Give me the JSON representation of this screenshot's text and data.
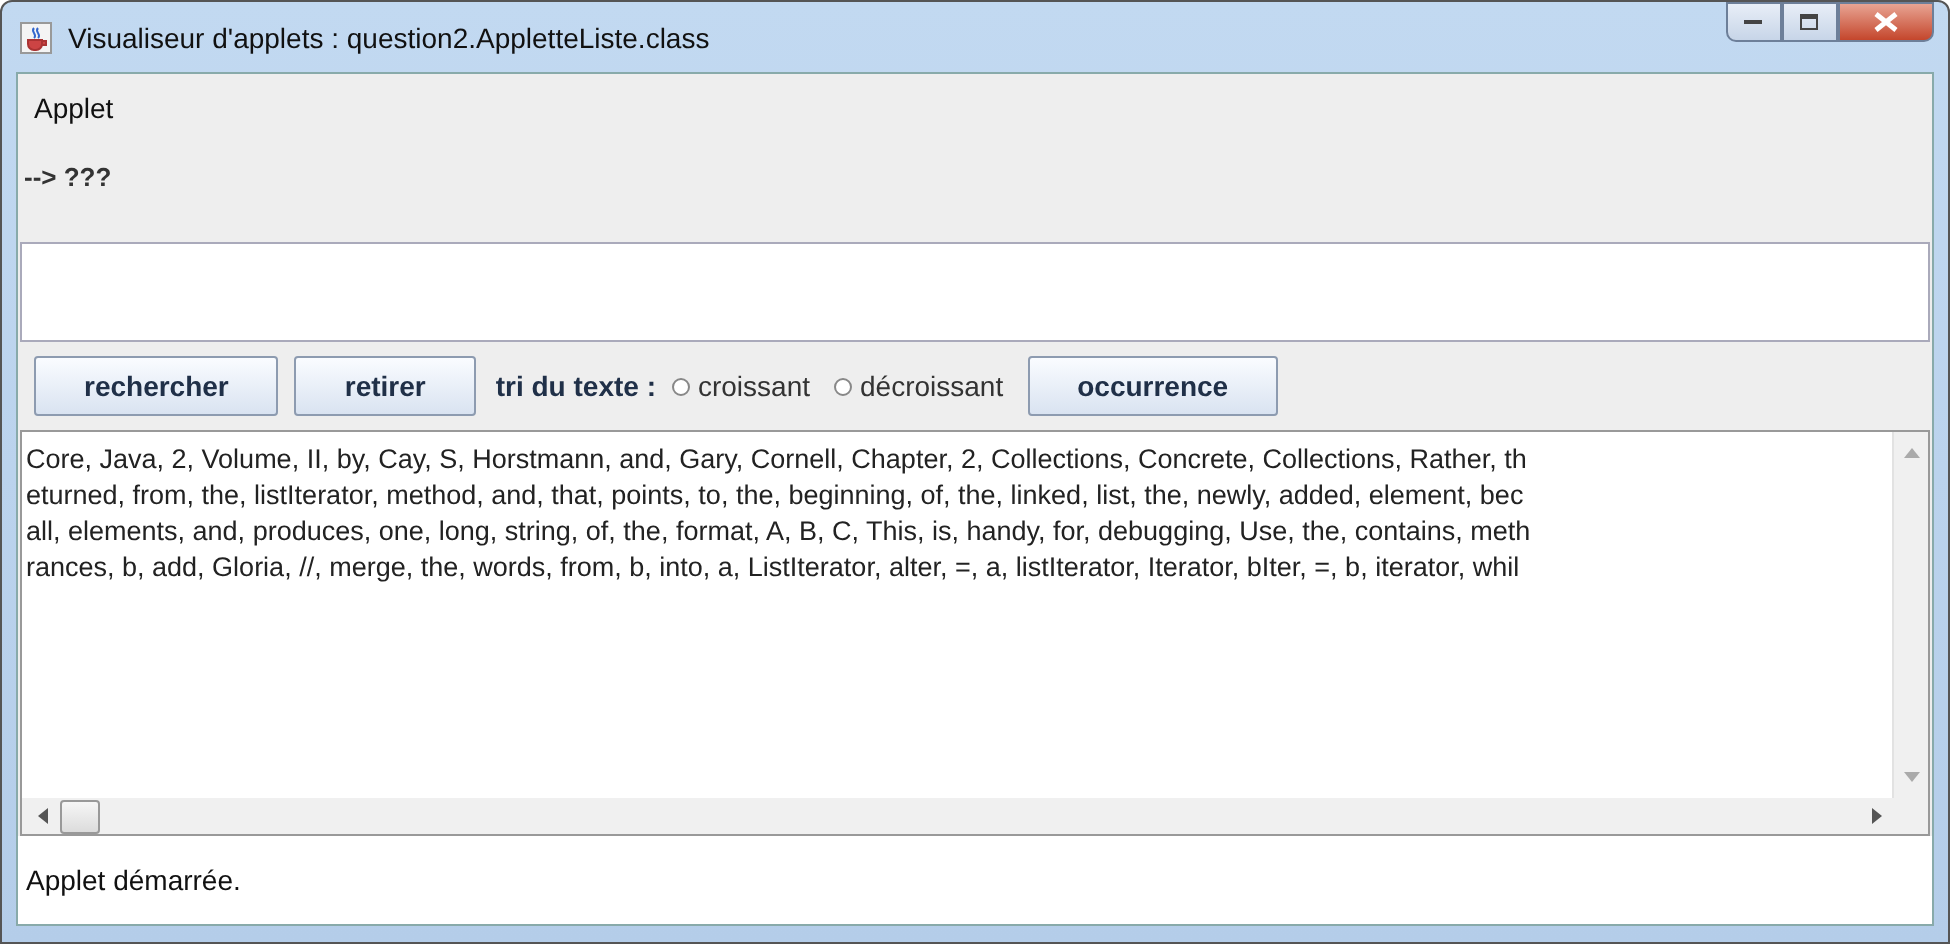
{
  "window": {
    "title": "Visualiseur d'applets : question2.AppletteListe.class"
  },
  "menu": [
    "Applet"
  ],
  "result_label": "--> ???",
  "controls": [
    {
      "kind": "button",
      "label": "rechercher"
    },
    {
      "kind": "button",
      "label": "retirer"
    },
    {
      "kind": "label",
      "label": "tri du texte :"
    },
    {
      "kind": "radio",
      "label": "croissant",
      "selected": false
    },
    {
      "kind": "radio",
      "label": "décroissant",
      "selected": false
    },
    {
      "kind": "button",
      "label": "occurrence"
    }
  ],
  "text_area": {
    "lines": [
      "Core, Java, 2, Volume, II, by, Cay, S, Horstmann, and, Gary, Cornell, Chapter, 2, Collections, Concrete, Collections, Rather, th",
      "eturned, from, the, listIterator, method, and, that, points, to, the, beginning, of, the, linked, list, the, newly, added, element, bec",
      "all, elements, and, produces, one, long, string, of, the, format, A, B, C, This, is, handy, for, debugging, Use, the, contains, meth",
      "rances, b, add, Gloria, //, merge, the, words, from, b, into, a, ListIterator, alter, =, a, listIterator, Iterator, bIter, =, b, iterator, whil"
    ]
  },
  "status_bar": "Applet démarrée."
}
